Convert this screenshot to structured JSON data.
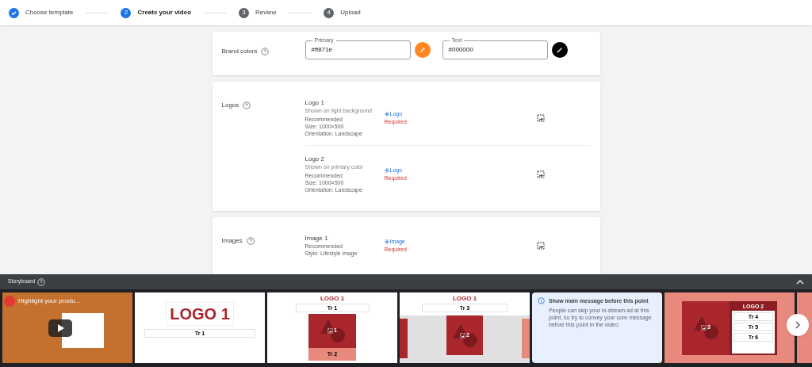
{
  "steps": [
    {
      "label": "Choose template",
      "completed": true,
      "selected": false
    },
    {
      "number": "2",
      "label": "Create your video",
      "completed": false,
      "selected": true
    },
    {
      "number": "3",
      "label": "Review",
      "completed": false,
      "selected": false
    },
    {
      "number": "4",
      "label": "Upload",
      "completed": false,
      "selected": false
    }
  ],
  "brand_colors": {
    "label": "Brand colors",
    "fields": [
      {
        "label": "Primary",
        "value": "#ff871e",
        "color": "#ff871e"
      },
      {
        "label": "Text",
        "value": "#000000",
        "color": "#000000"
      }
    ]
  },
  "sections": [
    {
      "label": "Logos",
      "items": [
        {
          "title": "Logo 1",
          "subtitle": "Shown on light background",
          "details": [
            "Recommended",
            "Size: 1000×500",
            "Orientation: Landscape"
          ],
          "add": "Logo",
          "required": "Required"
        },
        {
          "title": "Logo 2",
          "subtitle": "Shown on primary color",
          "details": [
            "Recommended",
            "Size: 1000×500",
            "Orientation: Landscape"
          ],
          "add": "Logo",
          "required": "Required"
        }
      ]
    },
    {
      "label": "Images",
      "items": [
        {
          "title": "Image 1",
          "details": [
            "Recommended",
            "Style: Lifestyle image"
          ],
          "add": "Image",
          "required": "Required"
        }
      ]
    }
  ],
  "storyboard": {
    "title": "Storyboard",
    "slides": [
      {
        "kind": "video",
        "title": "Highlight your produ..."
      },
      {
        "kind": "logo",
        "logo": "LOGO 1",
        "texts": [
          "Tr 1"
        ]
      },
      {
        "kind": "logo-image",
        "logo": "LOGO 1",
        "texts": [
          "Tr 1",
          "Tr 2"
        ],
        "image": "1"
      },
      {
        "kind": "logo-wide",
        "logo": "LOGO 1",
        "texts": [
          "Tr 3"
        ],
        "image": "2"
      },
      {
        "kind": "info",
        "heading": "Show main message before this point",
        "body": "People can skip your in-stream ad at this point, so try to convey your core message before this point in the video."
      },
      {
        "kind": "panel",
        "logo": "LOGO 2",
        "texts": [
          "Tr 4",
          "Tr 5",
          "Tr 6"
        ],
        "image": "3"
      },
      {
        "kind": "partial"
      }
    ]
  }
}
